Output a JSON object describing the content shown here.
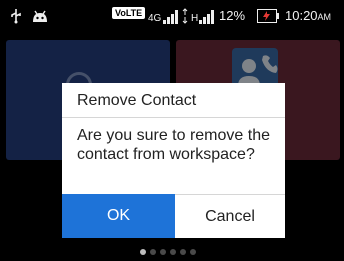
{
  "status_bar": {
    "icons": [
      "usb-icon",
      "android-icon",
      "signal-icon",
      "battery-charging-icon"
    ],
    "volte": "VoLTE",
    "net1": "4G",
    "net2": "H",
    "battery": "12%",
    "time": "10:20",
    "ampm": "AM"
  },
  "dialog": {
    "title": "Remove Contact",
    "message": "Are you sure to remove the contact from workspace?",
    "ok_label": "OK",
    "cancel_label": "Cancel"
  },
  "pager": {
    "page_count": 6,
    "current": 1
  },
  "colors": {
    "accent": "#1e73d8",
    "tile_left": "#253e7e",
    "tile_right": "#6a2a3a"
  }
}
